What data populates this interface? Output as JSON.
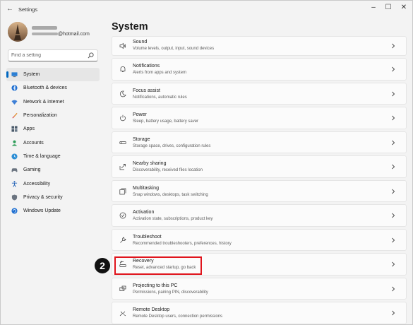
{
  "window": {
    "title": "Settings",
    "back_glyph": "←",
    "minimize_glyph": "–",
    "maximize_glyph": "☐",
    "close_glyph": "✕"
  },
  "user": {
    "email_suffix": "@hotmail.com"
  },
  "search": {
    "placeholder": "Find a setting"
  },
  "sidebar": {
    "items": [
      {
        "label": "System",
        "icon": "monitor-icon",
        "selected": true
      },
      {
        "label": "Bluetooth & devices",
        "icon": "bluetooth-icon"
      },
      {
        "label": "Network & internet",
        "icon": "wifi-icon"
      },
      {
        "label": "Personalization",
        "icon": "paintbrush-icon"
      },
      {
        "label": "Apps",
        "icon": "apps-icon"
      },
      {
        "label": "Accounts",
        "icon": "person-icon"
      },
      {
        "label": "Time & language",
        "icon": "globe-clock-icon"
      },
      {
        "label": "Gaming",
        "icon": "gamepad-icon"
      },
      {
        "label": "Accessibility",
        "icon": "accessibility-icon"
      },
      {
        "label": "Privacy & security",
        "icon": "shield-icon"
      },
      {
        "label": "Windows Update",
        "icon": "update-icon"
      }
    ]
  },
  "main": {
    "title": "System",
    "items": [
      {
        "title": "Sound",
        "subtitle": "Volume levels, output, input, sound devices",
        "icon": "speaker-icon"
      },
      {
        "title": "Notifications",
        "subtitle": "Alerts from apps and system",
        "icon": "bell-icon"
      },
      {
        "title": "Focus assist",
        "subtitle": "Notifications, automatic rules",
        "icon": "moon-icon"
      },
      {
        "title": "Power",
        "subtitle": "Sleep, battery usage, battery saver",
        "icon": "power-icon"
      },
      {
        "title": "Storage",
        "subtitle": "Storage space, drives, configuration rules",
        "icon": "drive-icon"
      },
      {
        "title": "Nearby sharing",
        "subtitle": "Discoverability, received files location",
        "icon": "share-icon"
      },
      {
        "title": "Multitasking",
        "subtitle": "Snap windows, desktops, task switching",
        "icon": "multitask-icon"
      },
      {
        "title": "Activation",
        "subtitle": "Activation state, subscriptions, product key",
        "icon": "check-circle-icon"
      },
      {
        "title": "Troubleshoot",
        "subtitle": "Recommended troubleshooters, preferences, history",
        "icon": "wrench-icon"
      },
      {
        "title": "Recovery",
        "subtitle": "Reset, advanced startup, go back",
        "icon": "recovery-icon"
      },
      {
        "title": "Projecting to this PC",
        "subtitle": "Permissions, pairing PIN, discoverability",
        "icon": "project-icon"
      },
      {
        "title": "Remote Desktop",
        "subtitle": "Remote Desktop users, connection permissions",
        "icon": "remote-desktop-icon"
      }
    ]
  },
  "annotation": {
    "step": "2",
    "highlight_color": "#e0141c"
  },
  "colors": {
    "accent": "#0067c0",
    "background": "#f3f3f3",
    "card": "#fbfbfb"
  }
}
